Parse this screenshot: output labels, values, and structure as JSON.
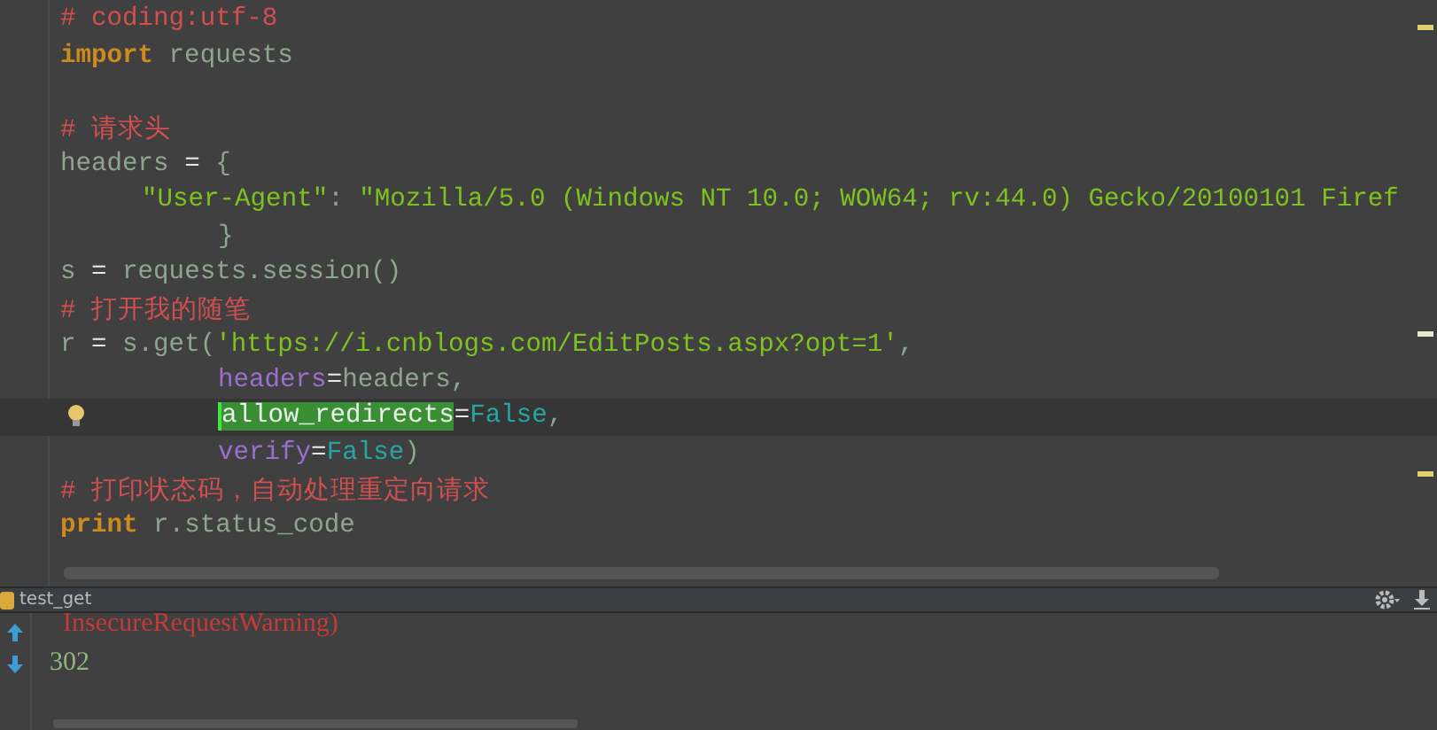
{
  "editor": {
    "lines": [
      {
        "kind": "top",
        "current": false,
        "segments": [
          {
            "kind": "comment",
            "text": "# coding:utf-8"
          }
        ]
      },
      {
        "kind": "top",
        "current": false,
        "segments": [
          {
            "kind": "keyword",
            "text": "import"
          },
          {
            "kind": "plain",
            "text": " requests"
          }
        ]
      },
      {
        "kind": "blank",
        "current": false
      },
      {
        "kind": "top",
        "current": false,
        "segments": [
          {
            "kind": "comment",
            "text": "# 请求头"
          }
        ]
      },
      {
        "kind": "top",
        "current": false,
        "segments": [
          {
            "kind": "plain",
            "text": "headers "
          },
          {
            "kind": "operator",
            "text": "="
          },
          {
            "kind": "plain",
            "text": " {"
          }
        ]
      },
      {
        "kind": "entry",
        "current": false,
        "segments": [
          {
            "kind": "string",
            "text": "\"User-Agent\""
          },
          {
            "kind": "plain",
            "text": ": "
          },
          {
            "kind": "string",
            "text": "\"Mozilla/5.0 (Windows NT 10.0; WOW64; rv:44.0) Gecko/20100101 Firef"
          }
        ]
      },
      {
        "kind": "argument",
        "current": false,
        "segments": [
          {
            "kind": "plain",
            "text": "}"
          }
        ]
      },
      {
        "kind": "top",
        "current": false,
        "segments": [
          {
            "kind": "plain",
            "text": "s "
          },
          {
            "kind": "operator",
            "text": "="
          },
          {
            "kind": "plain",
            "text": " requests.session()"
          }
        ]
      },
      {
        "kind": "top",
        "current": false,
        "segments": [
          {
            "kind": "comment",
            "text": "# 打开我的随笔"
          }
        ]
      },
      {
        "kind": "top",
        "current": false,
        "segments": [
          {
            "kind": "plain",
            "text": "r "
          },
          {
            "kind": "operator",
            "text": "="
          },
          {
            "kind": "plain",
            "text": " s.get("
          },
          {
            "kind": "string",
            "text": "'https://i.cnblogs.com/EditPosts.aspx?opt=1'"
          },
          {
            "kind": "plain",
            "text": ","
          }
        ]
      },
      {
        "kind": "argument",
        "current": false,
        "segments": [
          {
            "kind": "param",
            "text": "headers"
          },
          {
            "kind": "operator",
            "text": "="
          },
          {
            "kind": "plain",
            "text": "headers,"
          }
        ]
      },
      {
        "kind": "argument",
        "current": true,
        "segments": [
          {
            "kind": "highlight",
            "text": "allow_redirects"
          },
          {
            "kind": "operator",
            "text": "="
          },
          {
            "kind": "constant",
            "text": "False"
          },
          {
            "kind": "plain",
            "text": ","
          }
        ]
      },
      {
        "kind": "argument",
        "current": false,
        "segments": [
          {
            "kind": "param",
            "text": "verify"
          },
          {
            "kind": "operator",
            "text": "="
          },
          {
            "kind": "constant",
            "text": "False"
          },
          {
            "kind": "plain",
            "text": ")"
          }
        ]
      },
      {
        "kind": "top",
        "current": false,
        "segments": [
          {
            "kind": "comment",
            "text": "# 打印状态码，自动处理重定向请求"
          }
        ]
      },
      {
        "kind": "top",
        "current": false,
        "segments": [
          {
            "kind": "keyword",
            "text": "print"
          },
          {
            "kind": "plain",
            "text": " r.status_code"
          }
        ]
      }
    ]
  },
  "console": {
    "title": "test_get",
    "lines": [
      {
        "kind": "error",
        "text": "  InsecureRequestWarning)"
      },
      {
        "kind": "output",
        "text": "302"
      }
    ]
  }
}
